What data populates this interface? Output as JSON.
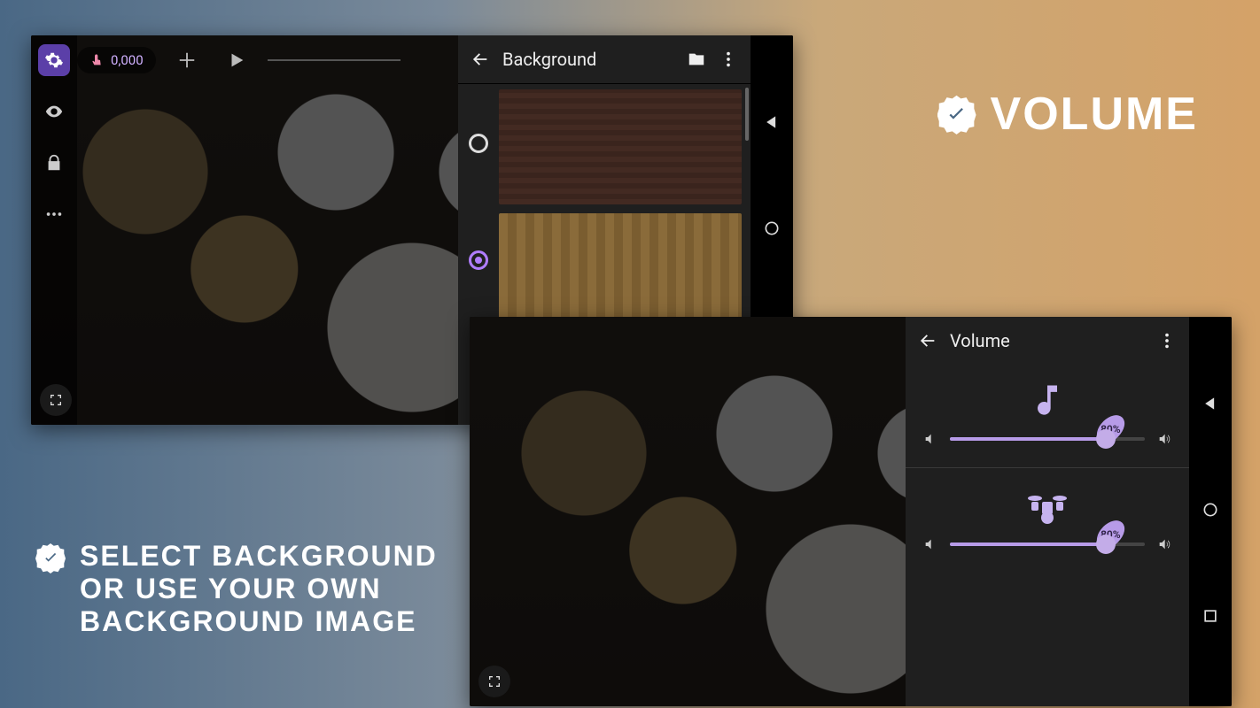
{
  "promo": {
    "volume_title": "VOLUME",
    "background_line1": "SELECT BACKGROUND",
    "background_line2": "OR USE YOUR OWN",
    "background_line3": "BACKGROUND IMAGE"
  },
  "top_screenshot": {
    "score": "0,000",
    "panel_title": "Background",
    "backgrounds": [
      {
        "id": "brick",
        "selected": false
      },
      {
        "id": "wood",
        "selected": true
      },
      {
        "id": "tile",
        "selected": false
      }
    ]
  },
  "bottom_screenshot": {
    "panel_title": "Volume",
    "sliders": {
      "music": {
        "percent": 80,
        "label": "80%"
      },
      "drums": {
        "percent": 80,
        "label": "80%"
      }
    }
  },
  "icons": {
    "gear": "gear-icon",
    "eye": "eye-icon",
    "lock": "lock-icon",
    "more": "more-icon",
    "fullscreen": "fullscreen-icon",
    "back_arrow": "back-arrow-icon",
    "folder": "folder-icon",
    "kebab": "kebab-icon",
    "nav_back": "nav-back-icon",
    "nav_home": "nav-home-icon",
    "nav_recent": "nav-recent-icon",
    "touch": "touch-icon",
    "plus": "plus-icon",
    "play": "play-icon",
    "music_note": "music-note-icon",
    "drum_kit": "drum-kit-icon",
    "speaker_low": "speaker-low-icon",
    "speaker_high": "speaker-high-icon",
    "check": "check-icon"
  },
  "colors": {
    "accent": "#b79be8",
    "panel_bg": "#1f1f1f",
    "gear_bg": "#5b3fa8"
  }
}
